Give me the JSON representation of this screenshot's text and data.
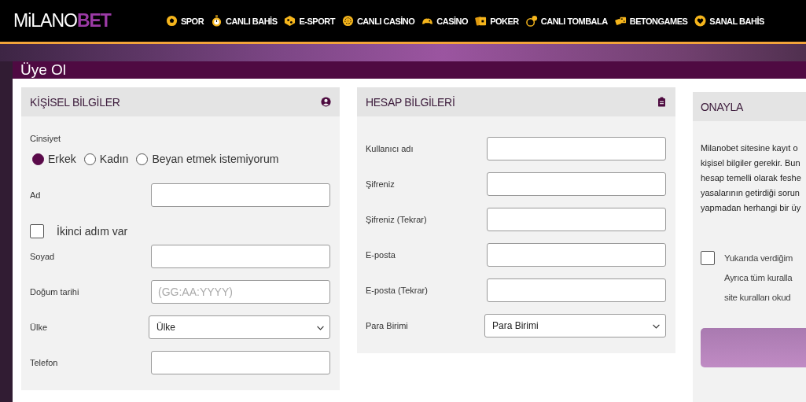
{
  "header": {
    "logo": {
      "text": "MiLANO",
      "accent": "BET"
    },
    "nav": [
      {
        "label": "SPOR"
      },
      {
        "label": "CANLI BAHİS"
      },
      {
        "label": "E-SPORT"
      },
      {
        "label": "CANLI CASİNO"
      },
      {
        "label": "CASİNO"
      },
      {
        "label": "POKER"
      },
      {
        "label": "CANLI TOMBALA"
      },
      {
        "label": "BETONGAMES"
      },
      {
        "label": "SANAL BAHİS"
      }
    ]
  },
  "page_title": "Üye Ol",
  "panels": [
    {
      "title": "KİŞİSEL BİLGİLER",
      "fields": [
        {
          "kind": "radio_group",
          "label": "Cinsiyet",
          "options": [
            {
              "label": "Erkek",
              "selected": true
            },
            {
              "label": "Kadın",
              "selected": false
            },
            {
              "label": "Beyan etmek istemiyorum",
              "selected": false
            }
          ]
        },
        {
          "kind": "input",
          "label": "Ad"
        },
        {
          "kind": "checkbox",
          "label": "İkinci adım var",
          "checked": false
        },
        {
          "kind": "input",
          "label": "Soyad"
        },
        {
          "kind": "input",
          "label": "Doğum tarihi",
          "placeholder": "(GG:AA:YYYY)"
        },
        {
          "kind": "select",
          "label": "Ülke",
          "value": "Ülke"
        },
        {
          "kind": "input",
          "label": "Telefon"
        }
      ]
    },
    {
      "title": "HESAP BİLGİLERİ",
      "fields": [
        {
          "kind": "input",
          "label": "Kullanıcı adı"
        },
        {
          "kind": "input",
          "label": "Şifreniz"
        },
        {
          "kind": "input",
          "label": "Şifreniz (Tekrar)"
        },
        {
          "kind": "input",
          "label": "E-posta"
        },
        {
          "kind": "input",
          "label": "E-posta (Tekrar)"
        },
        {
          "kind": "select",
          "label": "Para Birimi",
          "value": "Para Birimi"
        }
      ]
    }
  ],
  "confirm": {
    "title": "ONAYLA",
    "text": "Milanobet sitesine kayıt o\nkişisel bilgiler gerekir. Bun\nhesap temelli olarak feshe\nyasalarının getirdiği sorun\nyapmadan herhangi bir üy",
    "agreement": {
      "text": "Yukarıda verdiğim\nAyrıca tüm kuralla\nsite kuralları okud",
      "checked": false
    }
  }
}
